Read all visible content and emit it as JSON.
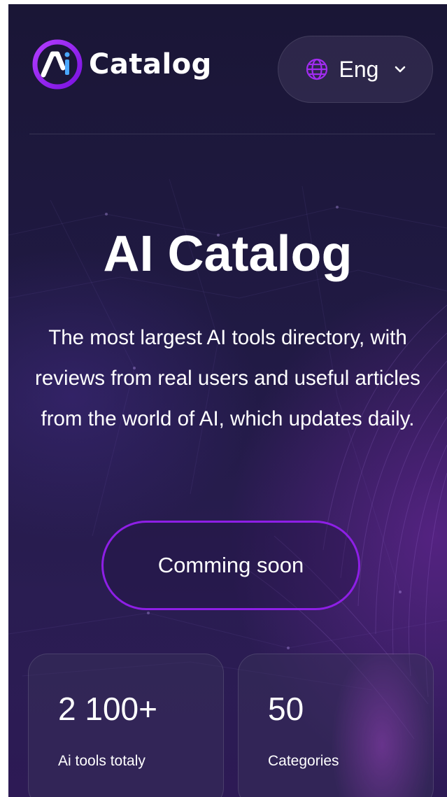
{
  "header": {
    "logo_text": "Catalog",
    "logo_mark_text": "Ai",
    "language": "Eng"
  },
  "hero": {
    "title": "AI Catalog",
    "description": "The most largest AI tools directory, with reviews from real users and useful articles from the world of AI, which updates daily.",
    "cta_label": "Comming soon"
  },
  "stats": [
    {
      "value": "2 100+",
      "label": "Ai tools totaly"
    },
    {
      "value": "50",
      "label": "Categories"
    }
  ],
  "icons": {
    "logo": "ai-logo-icon",
    "globe": "globe-icon",
    "chevron": "chevron-down-icon"
  },
  "colors": {
    "background": "#1a1636",
    "accent": "#8e1fe6",
    "text": "#ffffff"
  }
}
